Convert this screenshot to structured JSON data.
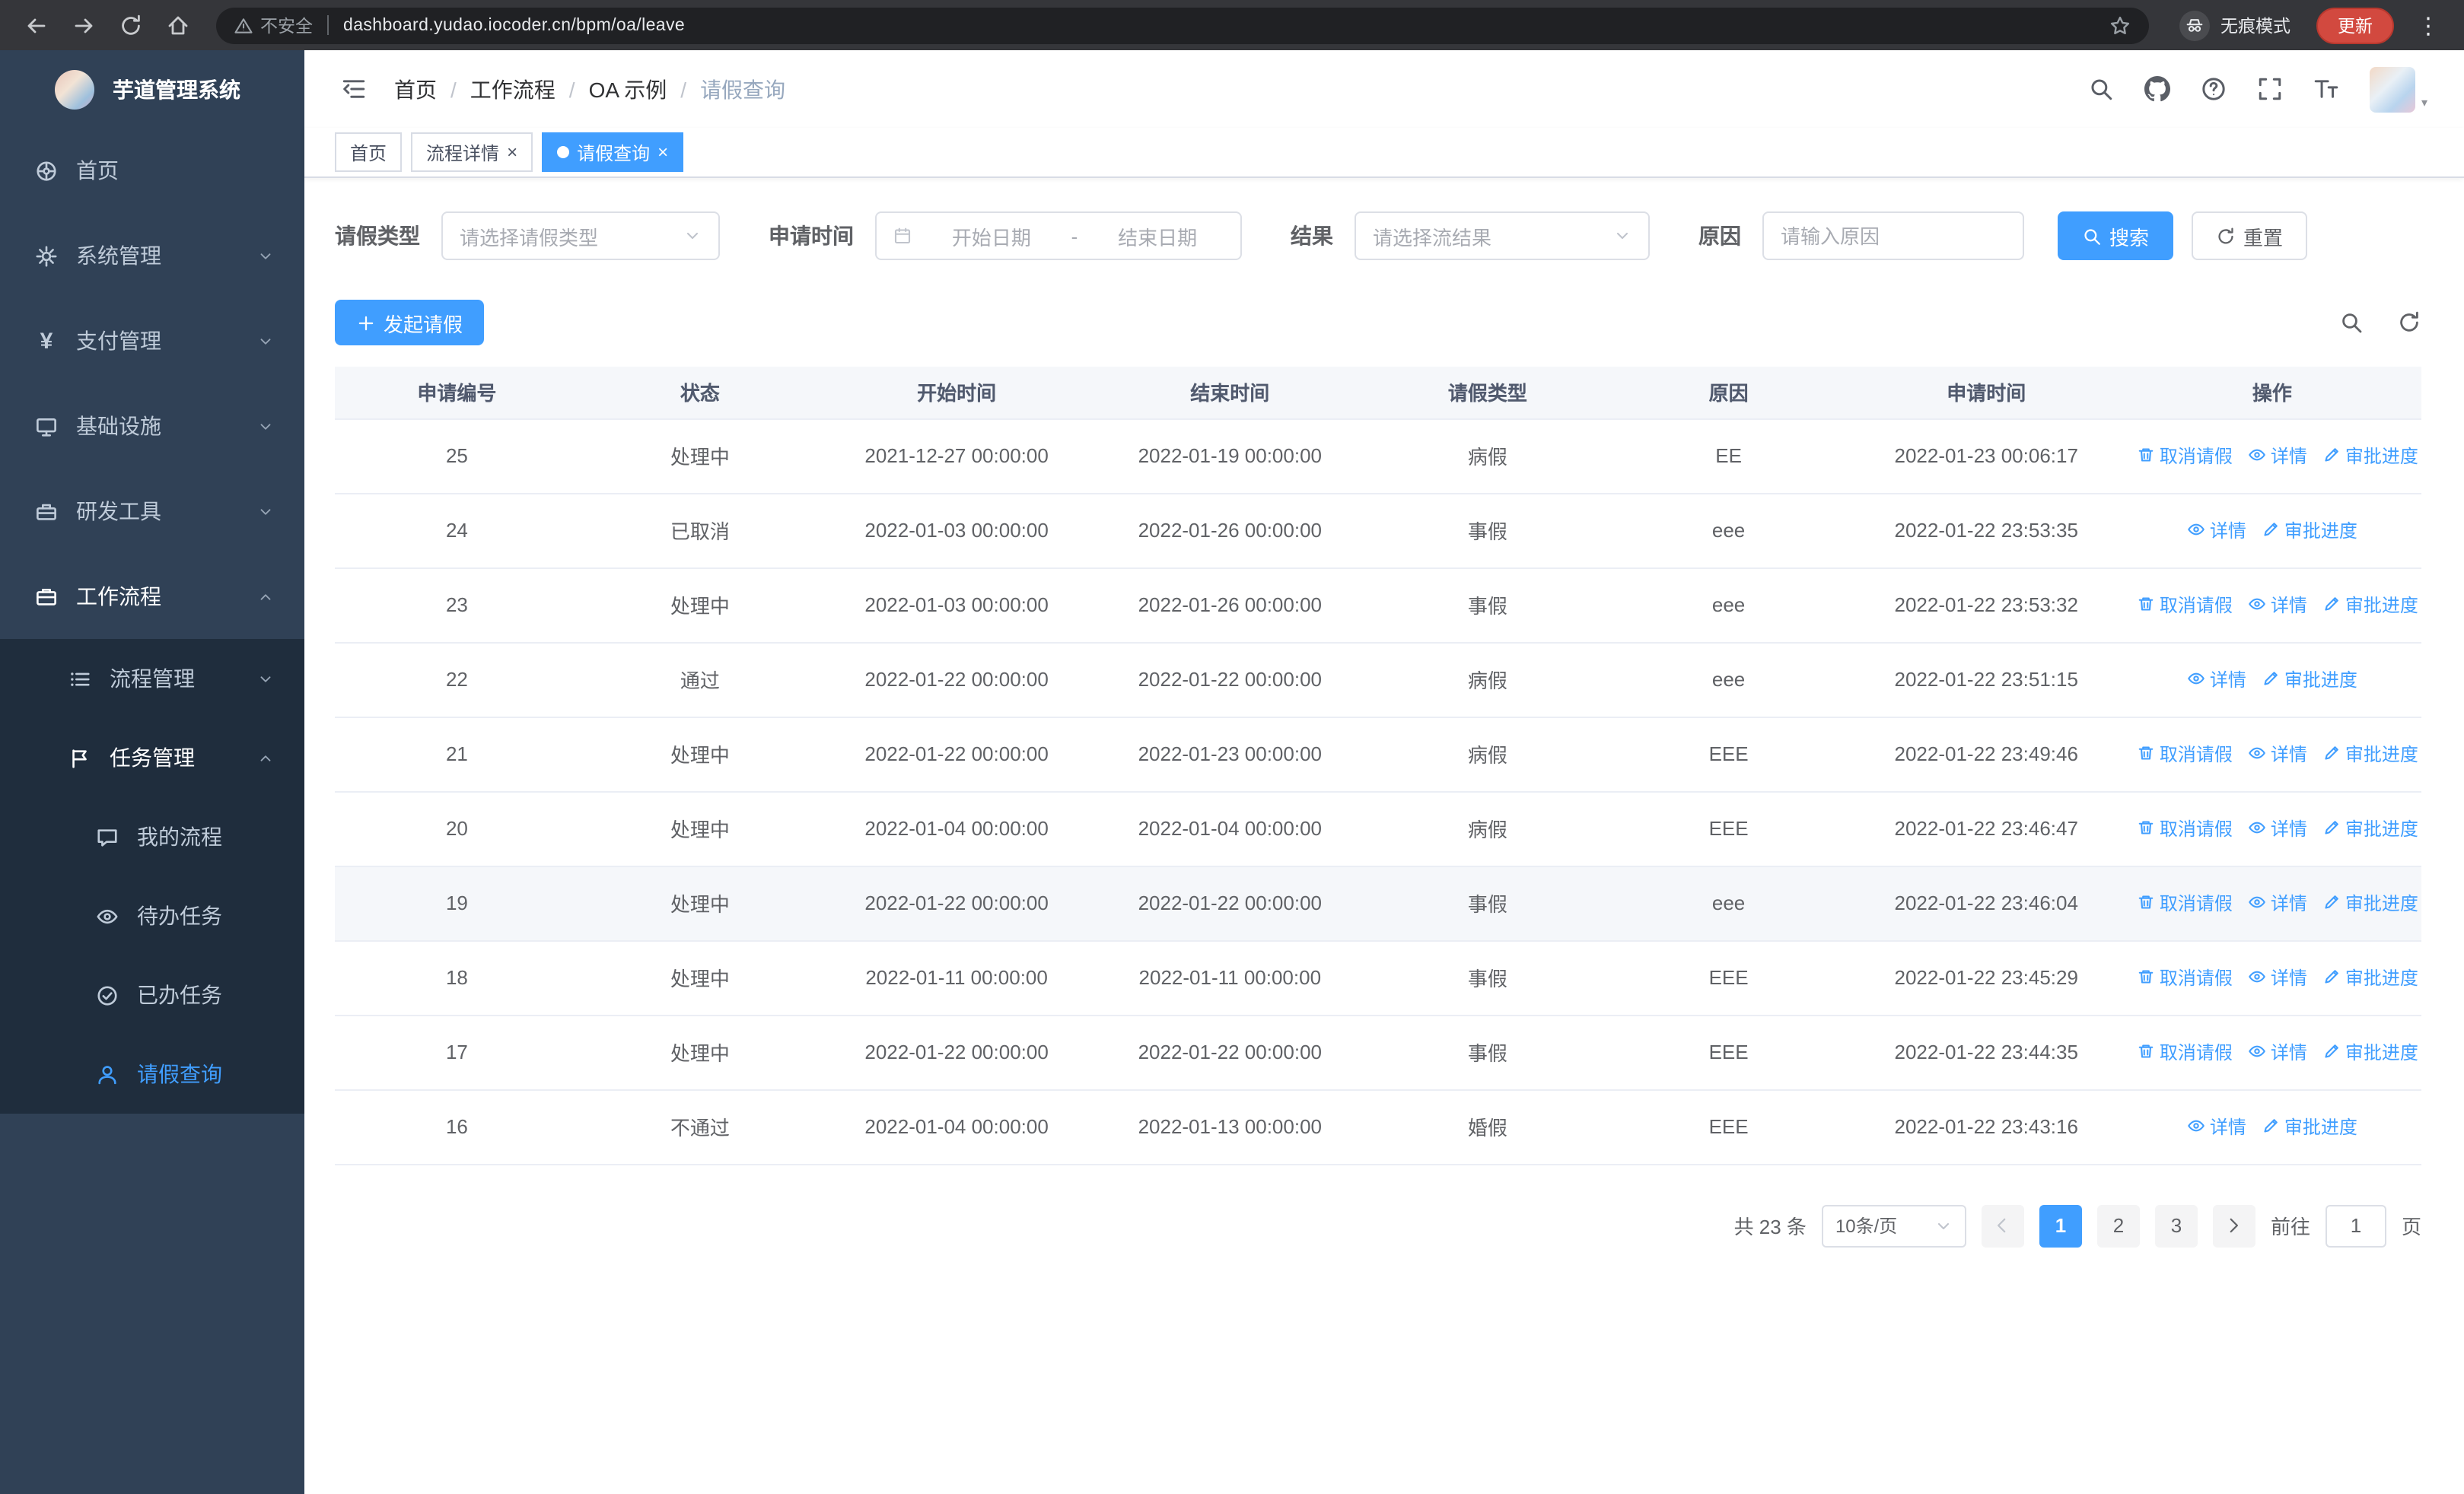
{
  "colors": {
    "primary": "#409eff",
    "sidebar_bg": "#304156",
    "sidebar_submenu_bg": "#1f2d3d",
    "update_button": "#d2493f",
    "table_header_bg": "#f5f7fa"
  },
  "browser": {
    "security_label": "不安全",
    "url": "dashboard.yudao.iocoder.cn/bpm/oa/leave",
    "incognito_label": "无痕模式",
    "update_label": "更新"
  },
  "sidebar": {
    "app_title": "芋道管理系统",
    "menu": [
      {
        "key": "home",
        "label": "首页",
        "icon": "dashboard-icon"
      },
      {
        "key": "system",
        "label": "系统管理",
        "icon": "gear-icon",
        "arrow": "down"
      },
      {
        "key": "payment",
        "label": "支付管理",
        "icon": "yen-icon",
        "arrow": "down"
      },
      {
        "key": "infrastructure",
        "label": "基础设施",
        "icon": "monitor-icon",
        "arrow": "down"
      },
      {
        "key": "devtools",
        "label": "研发工具",
        "icon": "toolbox-icon",
        "arrow": "down"
      },
      {
        "key": "workflow",
        "label": "工作流程",
        "icon": "briefcase-icon",
        "arrow": "up",
        "open": true,
        "children": [
          {
            "key": "process-mgmt",
            "label": "流程管理",
            "icon": "list-icon",
            "arrow": "down"
          },
          {
            "key": "task-mgmt",
            "label": "任务管理",
            "icon": "flag-icon",
            "arrow": "up",
            "open": true,
            "children": [
              {
                "key": "my-process",
                "label": "我的流程",
                "icon": "chat-icon"
              },
              {
                "key": "todo-tasks",
                "label": "待办任务",
                "icon": "eye-icon"
              },
              {
                "key": "done-tasks",
                "label": "已办任务",
                "icon": "check-circle-icon"
              },
              {
                "key": "leave-query",
                "label": "请假查询",
                "icon": "user-icon",
                "active": true
              }
            ]
          }
        ]
      }
    ]
  },
  "header": {
    "breadcrumb": [
      "首页",
      "工作流程",
      "OA 示例",
      "请假查询"
    ],
    "separator": "/",
    "icons": [
      "search-icon",
      "github-icon",
      "help-icon",
      "fullscreen-icon",
      "font-size-icon"
    ]
  },
  "tabs": [
    {
      "label": "首页",
      "closable": false,
      "active": false
    },
    {
      "label": "流程详情",
      "closable": true,
      "active": false
    },
    {
      "label": "请假查询",
      "closable": true,
      "active": true
    }
  ],
  "filters": {
    "leave_type_label": "请假类型",
    "leave_type_placeholder": "请选择请假类型",
    "apply_time_label": "申请时间",
    "start_date_placeholder": "开始日期",
    "range_separator": "-",
    "end_date_placeholder": "结束日期",
    "result_label": "结果",
    "result_placeholder": "请选择流结果",
    "reason_label": "原因",
    "reason_placeholder": "请输入原因",
    "search_label": "搜索",
    "reset_label": "重置"
  },
  "toolbar": {
    "create_label": "发起请假"
  },
  "table": {
    "columns": [
      "申请编号",
      "状态",
      "开始时间",
      "结束时间",
      "请假类型",
      "原因",
      "申请时间",
      "操作"
    ],
    "actions": [
      {
        "key": "cancel",
        "label": "取消请假",
        "icon": "delete-icon",
        "requires_cancellable": true
      },
      {
        "key": "detail",
        "label": "详情",
        "icon": "eye-icon",
        "requires_cancellable": false
      },
      {
        "key": "progress",
        "label": "审批进度",
        "icon": "edit-icon",
        "requires_cancellable": false
      }
    ],
    "rows": [
      {
        "id": "25",
        "status": "处理中",
        "start": "2021-12-27 00:00:00",
        "end": "2022-01-19 00:00:00",
        "type": "病假",
        "reason": "EE",
        "applied": "2022-01-23 00:06:17",
        "cancellable": true,
        "highlighted": false
      },
      {
        "id": "24",
        "status": "已取消",
        "start": "2022-01-03 00:00:00",
        "end": "2022-01-26 00:00:00",
        "type": "事假",
        "reason": "eee",
        "applied": "2022-01-22 23:53:35",
        "cancellable": false,
        "highlighted": false
      },
      {
        "id": "23",
        "status": "处理中",
        "start": "2022-01-03 00:00:00",
        "end": "2022-01-26 00:00:00",
        "type": "事假",
        "reason": "eee",
        "applied": "2022-01-22 23:53:32",
        "cancellable": true,
        "highlighted": false
      },
      {
        "id": "22",
        "status": "通过",
        "start": "2022-01-22 00:00:00",
        "end": "2022-01-22 00:00:00",
        "type": "病假",
        "reason": "eee",
        "applied": "2022-01-22 23:51:15",
        "cancellable": false,
        "highlighted": false
      },
      {
        "id": "21",
        "status": "处理中",
        "start": "2022-01-22 00:00:00",
        "end": "2022-01-23 00:00:00",
        "type": "病假",
        "reason": "EEE",
        "applied": "2022-01-22 23:49:46",
        "cancellable": true,
        "highlighted": false
      },
      {
        "id": "20",
        "status": "处理中",
        "start": "2022-01-04 00:00:00",
        "end": "2022-01-04 00:00:00",
        "type": "病假",
        "reason": "EEE",
        "applied": "2022-01-22 23:46:47",
        "cancellable": true,
        "highlighted": false
      },
      {
        "id": "19",
        "status": "处理中",
        "start": "2022-01-22 00:00:00",
        "end": "2022-01-22 00:00:00",
        "type": "事假",
        "reason": "eee",
        "applied": "2022-01-22 23:46:04",
        "cancellable": true,
        "highlighted": true
      },
      {
        "id": "18",
        "status": "处理中",
        "start": "2022-01-11 00:00:00",
        "end": "2022-01-11 00:00:00",
        "type": "事假",
        "reason": "EEE",
        "applied": "2022-01-22 23:45:29",
        "cancellable": true,
        "highlighted": false
      },
      {
        "id": "17",
        "status": "处理中",
        "start": "2022-01-22 00:00:00",
        "end": "2022-01-22 00:00:00",
        "type": "事假",
        "reason": "EEE",
        "applied": "2022-01-22 23:44:35",
        "cancellable": true,
        "highlighted": false
      },
      {
        "id": "16",
        "status": "不通过",
        "start": "2022-01-04 00:00:00",
        "end": "2022-01-13 00:00:00",
        "type": "婚假",
        "reason": "EEE",
        "applied": "2022-01-22 23:43:16",
        "cancellable": false,
        "highlighted": false
      }
    ]
  },
  "pagination": {
    "total_text": "共 23 条",
    "page_size": "10条/页",
    "pages": [
      "1",
      "2",
      "3"
    ],
    "active_page": "1",
    "prev_disabled": true,
    "goto_label": "前往",
    "goto_value": "1",
    "goto_suffix": "页"
  }
}
